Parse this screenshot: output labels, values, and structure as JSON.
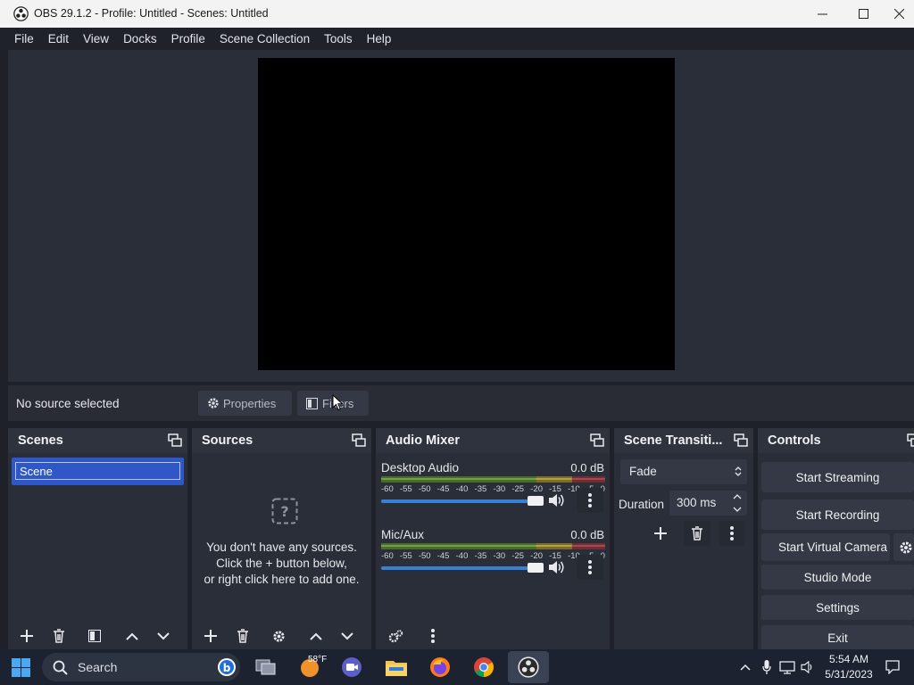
{
  "window": {
    "title": "OBS 29.1.2 - Profile: Untitled - Scenes: Untitled"
  },
  "menu": [
    "File",
    "Edit",
    "View",
    "Docks",
    "Profile",
    "Scene Collection",
    "Tools",
    "Help"
  ],
  "source_bar": {
    "status": "No source selected",
    "properties_label": "Properties",
    "filters_label": "Filters"
  },
  "scenes": {
    "title": "Scenes",
    "items": [
      "Scene"
    ]
  },
  "sources": {
    "title": "Sources",
    "empty_lines": [
      "You don't have any sources.",
      "Click the + button below,",
      "or right click here to add one."
    ]
  },
  "audio_mixer": {
    "title": "Audio Mixer",
    "ticks": [
      "-60",
      "-55",
      "-50",
      "-45",
      "-40",
      "-35",
      "-30",
      "-25",
      "-20",
      "-15",
      "-10",
      "-5",
      "0"
    ],
    "channels": [
      {
        "name": "Desktop Audio",
        "level": "0.0 dB",
        "volume_fraction": 1.0
      },
      {
        "name": "Mic/Aux",
        "level": "0.0 dB",
        "volume_fraction": 1.0
      }
    ]
  },
  "transitions": {
    "title": "Scene Transiti...",
    "selected": "Fade",
    "duration_label": "Duration",
    "duration_value": "300 ms"
  },
  "controls": {
    "title": "Controls",
    "start_streaming": "Start Streaming",
    "start_recording": "Start Recording",
    "start_virtual_camera": "Start Virtual Camera",
    "studio_mode": "Studio Mode",
    "settings": "Settings",
    "exit": "Exit"
  },
  "taskbar": {
    "search_label": "Search",
    "weather": "58°F",
    "time": "5:54 AM",
    "date": "5/31/2023"
  },
  "colors": {
    "selected_scene": "#2f57c7",
    "volume_slider": "#3a7fd6",
    "preview": "#000000"
  }
}
